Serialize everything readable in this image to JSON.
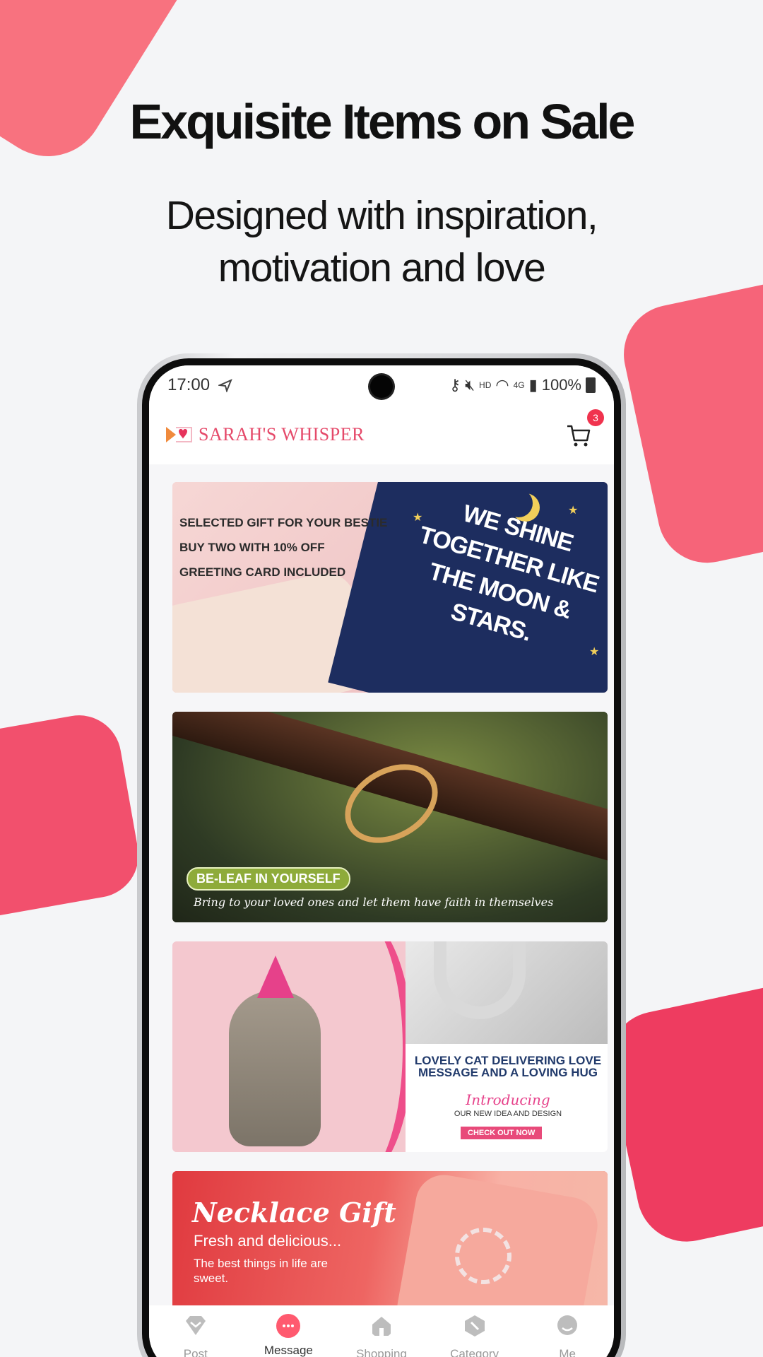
{
  "promo": {
    "headline": "Exquisite Items on Sale",
    "subline_1": "Designed with inspiration,",
    "subline_2": "motivation and love"
  },
  "status_bar": {
    "time": "17:00",
    "network": "HD",
    "network_type": "4G",
    "battery": "100%"
  },
  "app_bar": {
    "brand": "SARAH'S WHISPER",
    "cart_count": "3"
  },
  "banners": [
    {
      "promo_lines": [
        "SELECTED GIFT FOR YOUR BESTIE",
        "BUY TWO WITH 10% OFF",
        "GREETING CARD INCLUDED"
      ],
      "card_text": "WE SHINE TOGETHER LIKE THE MOON & STARS."
    },
    {
      "tag": "BE-LEAF IN YOURSELF",
      "tagline": "Bring to your loved ones and let them have faith in themselves"
    },
    {
      "headline": "LOVELY CAT DELIVERING LOVE MESSAGE AND A LOVING HUG",
      "intro": "Introducing",
      "idea": "OUR NEW IDEA AND DESIGN",
      "cta": "CHECK OUT NOW"
    },
    {
      "title": "Necklace Gift",
      "subtitle": "Fresh and delicious...",
      "body": "The best things in life are sweet."
    }
  ],
  "tabs": [
    {
      "label": "Post",
      "icon": "gem-icon"
    },
    {
      "label": "Message",
      "icon": "chat-icon"
    },
    {
      "label": "Shopping",
      "icon": "home-icon"
    },
    {
      "label": "Category",
      "icon": "category-icon"
    },
    {
      "label": "Me",
      "icon": "profile-icon"
    }
  ],
  "colors": {
    "accent": "#ff5a6f",
    "brand": "#e54a6a",
    "badge": "#f0334e"
  }
}
